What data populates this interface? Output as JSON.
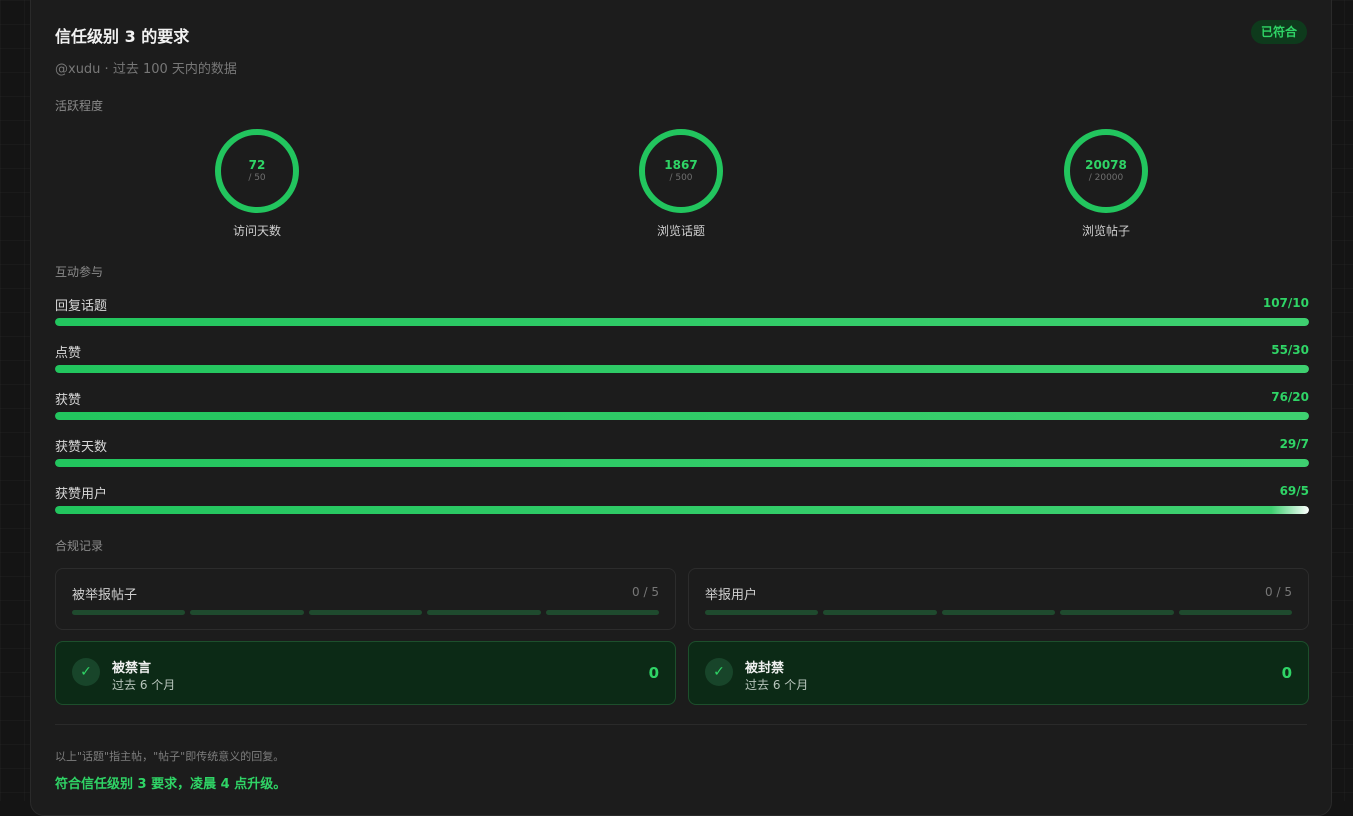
{
  "header": {
    "title": "信任级别 3 的要求",
    "badge": "已符合",
    "subtitle": "@xudu · 过去 100 天内的数据"
  },
  "activity": {
    "label": "活跃程度",
    "items": [
      {
        "value": "72",
        "max": "/ 50",
        "label": "访问天数"
      },
      {
        "value": "1867",
        "max": "/ 500",
        "label": "浏览话题"
      },
      {
        "value": "20078",
        "max": "/ 20000",
        "label": "浏览帖子"
      }
    ]
  },
  "engagement": {
    "label": "互动参与",
    "items": [
      {
        "label": "回复话题",
        "value": "107/10",
        "progress": 1.0
      },
      {
        "label": "点赞",
        "value": "55/30",
        "progress": 1.0
      },
      {
        "label": "获赞",
        "value": "76/20",
        "progress": 1.0
      },
      {
        "label": "获赞天数",
        "value": "29/7",
        "progress": 1.0
      },
      {
        "label": "获赞用户",
        "value": "69/5",
        "progress": 1.0
      }
    ]
  },
  "compliance": {
    "label": "合规记录",
    "flagged_posts": {
      "label": "被举报帖子",
      "count": "0 / 5",
      "segments": 5
    },
    "flagged_users": {
      "label": "举报用户",
      "count": "0 / 5",
      "segments": 5
    },
    "silenced": {
      "label": "被禁言",
      "sub": "过去 6 个月",
      "value": "0"
    },
    "suspended": {
      "label": "被封禁",
      "sub": "过去 6 个月",
      "value": "0"
    }
  },
  "footer": {
    "note": "以上\"话题\"指主帖，\"帖子\"即传统意义的回复。",
    "result": "符合信任级别 3 要求，凌晨 4 点升级。"
  },
  "colors": {
    "accent": "#22c55e",
    "background": "#1c1c1c",
    "ok_background": "#0c2a16"
  }
}
